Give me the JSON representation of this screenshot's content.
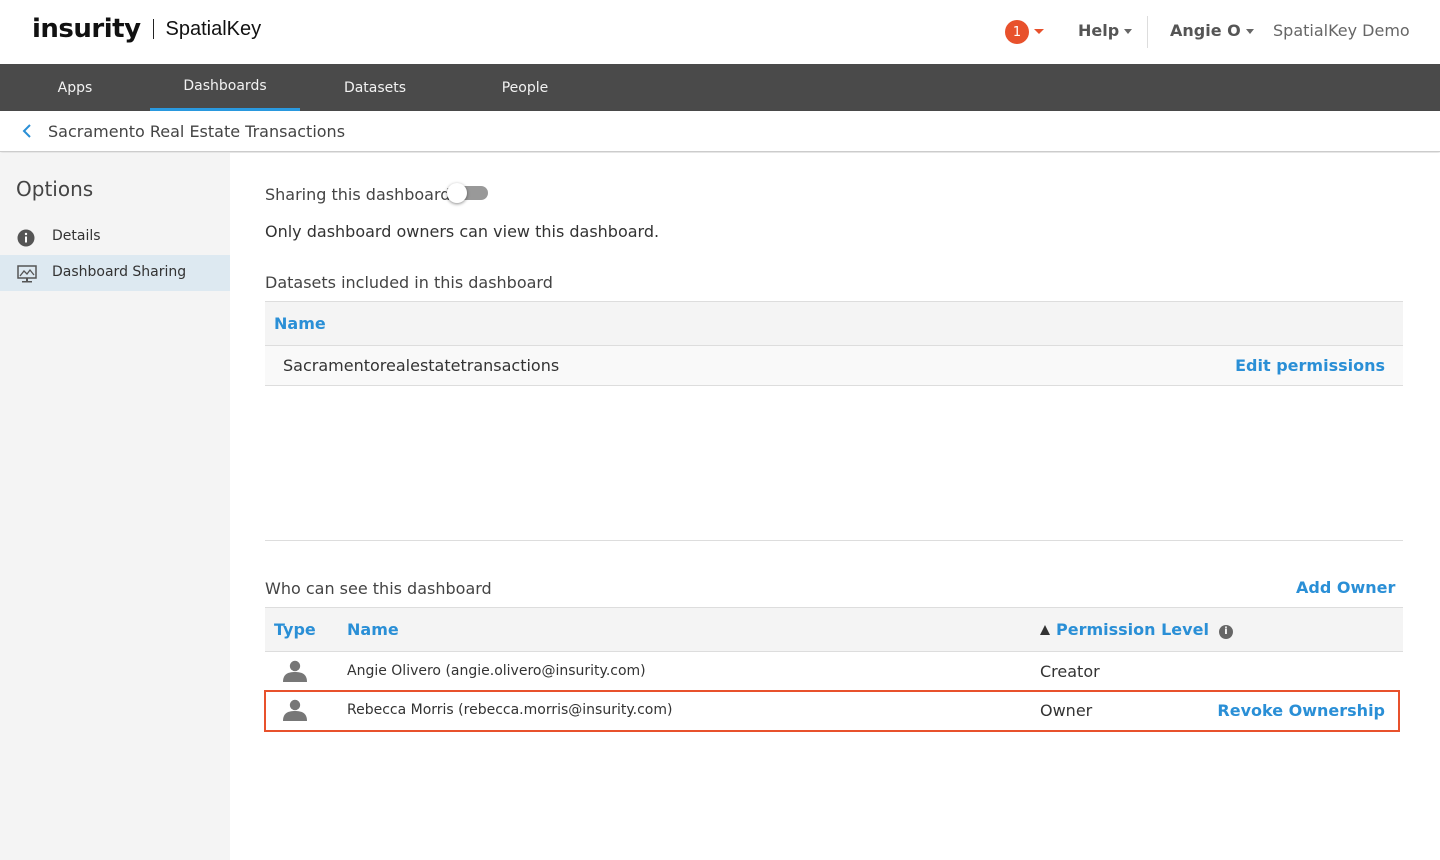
{
  "header": {
    "logo_main": "insurity",
    "logo_sub": "SpatialKey",
    "notification_count": "1",
    "help_label": "Help",
    "user_label": "Angie O",
    "org_label": "SpatialKey Demo"
  },
  "nav": {
    "items": [
      {
        "label": "Apps"
      },
      {
        "label": "Dashboards"
      },
      {
        "label": "Datasets"
      },
      {
        "label": "People"
      }
    ],
    "active": "Dashboards"
  },
  "breadcrumb": {
    "title": "Sacramento Real Estate Transactions"
  },
  "sidebar": {
    "title": "Options",
    "items": [
      {
        "label": "Details",
        "icon": "info-icon"
      },
      {
        "label": "Dashboard Sharing",
        "icon": "monitor-icon"
      }
    ],
    "active": "Dashboard Sharing"
  },
  "sharing": {
    "label": "Sharing this dashboard",
    "enabled": false,
    "description": "Only dashboard owners can view this dashboard."
  },
  "datasets": {
    "title": "Datasets included in this dashboard",
    "column_name": "Name",
    "rows": [
      {
        "name": "Sacramentorealestatetransactions",
        "action": "Edit permissions"
      }
    ]
  },
  "who": {
    "title": "Who can see this dashboard",
    "add_owner": "Add Owner",
    "columns": {
      "type": "Type",
      "name": "Name",
      "permission": "Permission Level"
    },
    "rows": [
      {
        "name": "Angie Olivero (angie.olivero@insurity.com)",
        "permission": "Creator",
        "action": ""
      },
      {
        "name": "Rebecca Morris (rebecca.morris@insurity.com)",
        "permission": "Owner",
        "action": "Revoke Ownership"
      }
    ]
  },
  "colors": {
    "accent": "#2a8fd6",
    "nav_bg": "#4a4a4a",
    "alert": "#e8512c"
  }
}
